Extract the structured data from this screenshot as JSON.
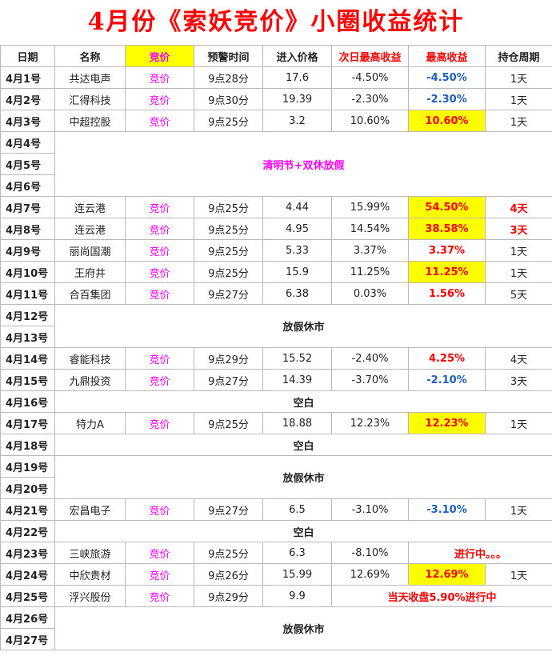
{
  "title": "4月份《索妖竞价》小圈收益统计",
  "headers": [
    "日期",
    "名称",
    "竞价",
    "预警时间",
    "进入价格",
    "次日最高收益",
    "最高收益",
    "持仓周期"
  ],
  "rows": [
    {
      "date": "4月1号",
      "name": "共达电声",
      "bid": "竞价",
      "time": "9点28分",
      "price": "17.6",
      "next": "-4.50%",
      "max": "-4.50%",
      "hold": "1天"
    },
    {
      "date": "4月2号",
      "name": "汇得科技",
      "bid": "竞价",
      "time": "9点30分",
      "price": "19.39",
      "next": "-2.30%",
      "max": "-2.30%",
      "hold": "1天"
    },
    {
      "date": "4月3号",
      "name": "中超控股",
      "bid": "竞价",
      "time": "9点25分",
      "price": "3.2",
      "next": "10.60%",
      "max": "10.60%",
      "hold": "1天"
    },
    {
      "date": "4月4号"
    },
    {
      "date": "4月5号"
    },
    {
      "date": "4月6号"
    },
    {
      "date": "4月7号",
      "name": "连云港",
      "bid": "竞价",
      "time": "9点25分",
      "price": "4.44",
      "next": "15.99%",
      "max": "54.50%",
      "hold": "4天"
    },
    {
      "date": "4月8号",
      "name": "连云港",
      "bid": "竞价",
      "time": "9点25分",
      "price": "4.95",
      "next": "14.54%",
      "max": "38.58%",
      "hold": "3天"
    },
    {
      "date": "4月9号",
      "name": "丽尚国潮",
      "bid": "竞价",
      "time": "9点25分",
      "price": "5.33",
      "next": "3.37%",
      "max": "3.37%",
      "hold": "1天"
    },
    {
      "date": "4月10号",
      "name": "王府井",
      "bid": "竞价",
      "time": "9点25分",
      "price": "15.9",
      "next": "11.25%",
      "max": "11.25%",
      "hold": "1天"
    },
    {
      "date": "4月11号",
      "name": "合百集团",
      "bid": "竞价",
      "time": "9点27分",
      "price": "6.38",
      "next": "0.03%",
      "max": "1.56%",
      "hold": "5天"
    },
    {
      "date": "4月12号"
    },
    {
      "date": "4月13号"
    },
    {
      "date": "4月14号",
      "name": "睿能科技",
      "bid": "竞价",
      "time": "9点29分",
      "price": "15.52",
      "next": "-2.40%",
      "max": "4.25%",
      "hold": "4天"
    },
    {
      "date": "4月15号",
      "name": "九鼎投资",
      "bid": "竞价",
      "time": "9点27分",
      "price": "14.39",
      "next": "-3.70%",
      "max": "-2.10%",
      "hold": "3天"
    },
    {
      "date": "4月16号"
    },
    {
      "date": "4月17号",
      "name": "特力A",
      "bid": "竞价",
      "time": "9点25分",
      "price": "18.88",
      "next": "12.23%",
      "max": "12.23%",
      "hold": "1天"
    },
    {
      "date": "4月18号"
    },
    {
      "date": "4月19号"
    },
    {
      "date": "4月20号"
    },
    {
      "date": "4月21号",
      "name": "宏昌电子",
      "bid": "竞价",
      "time": "9点27分",
      "price": "6.5",
      "next": "-3.10%",
      "max": "-3.10%",
      "hold": "1天"
    },
    {
      "date": "4月22号"
    },
    {
      "date": "4月23号",
      "name": "三峡旅游",
      "bid": "竞价",
      "time": "9点25分",
      "price": "6.3",
      "next": "-8.10%",
      "status": "进行中。。。"
    },
    {
      "date": "4月24号",
      "name": "中欣贵材",
      "bid": "竞价",
      "time": "9点26分",
      "price": "15.99",
      "next": "12.69%",
      "max": "12.69%",
      "hold": "1天"
    },
    {
      "date": "4月25号",
      "name": "浮兴股份",
      "bid": "竞价",
      "time": "9点29分",
      "price": "9.9",
      "status": "当天收盘5.90%进行中"
    },
    {
      "date": "4月26号"
    },
    {
      "date": "4月27号"
    }
  ],
  "notes": {
    "qingming": "清明节+双休放假",
    "holiday": "放假休市",
    "blank": "空白"
  },
  "colors": {
    "title": "#ff0000",
    "bid": "#ff00ff",
    "highlight": "#ffff00",
    "positive": "#ff0000",
    "negative": "#1f5fbf"
  }
}
